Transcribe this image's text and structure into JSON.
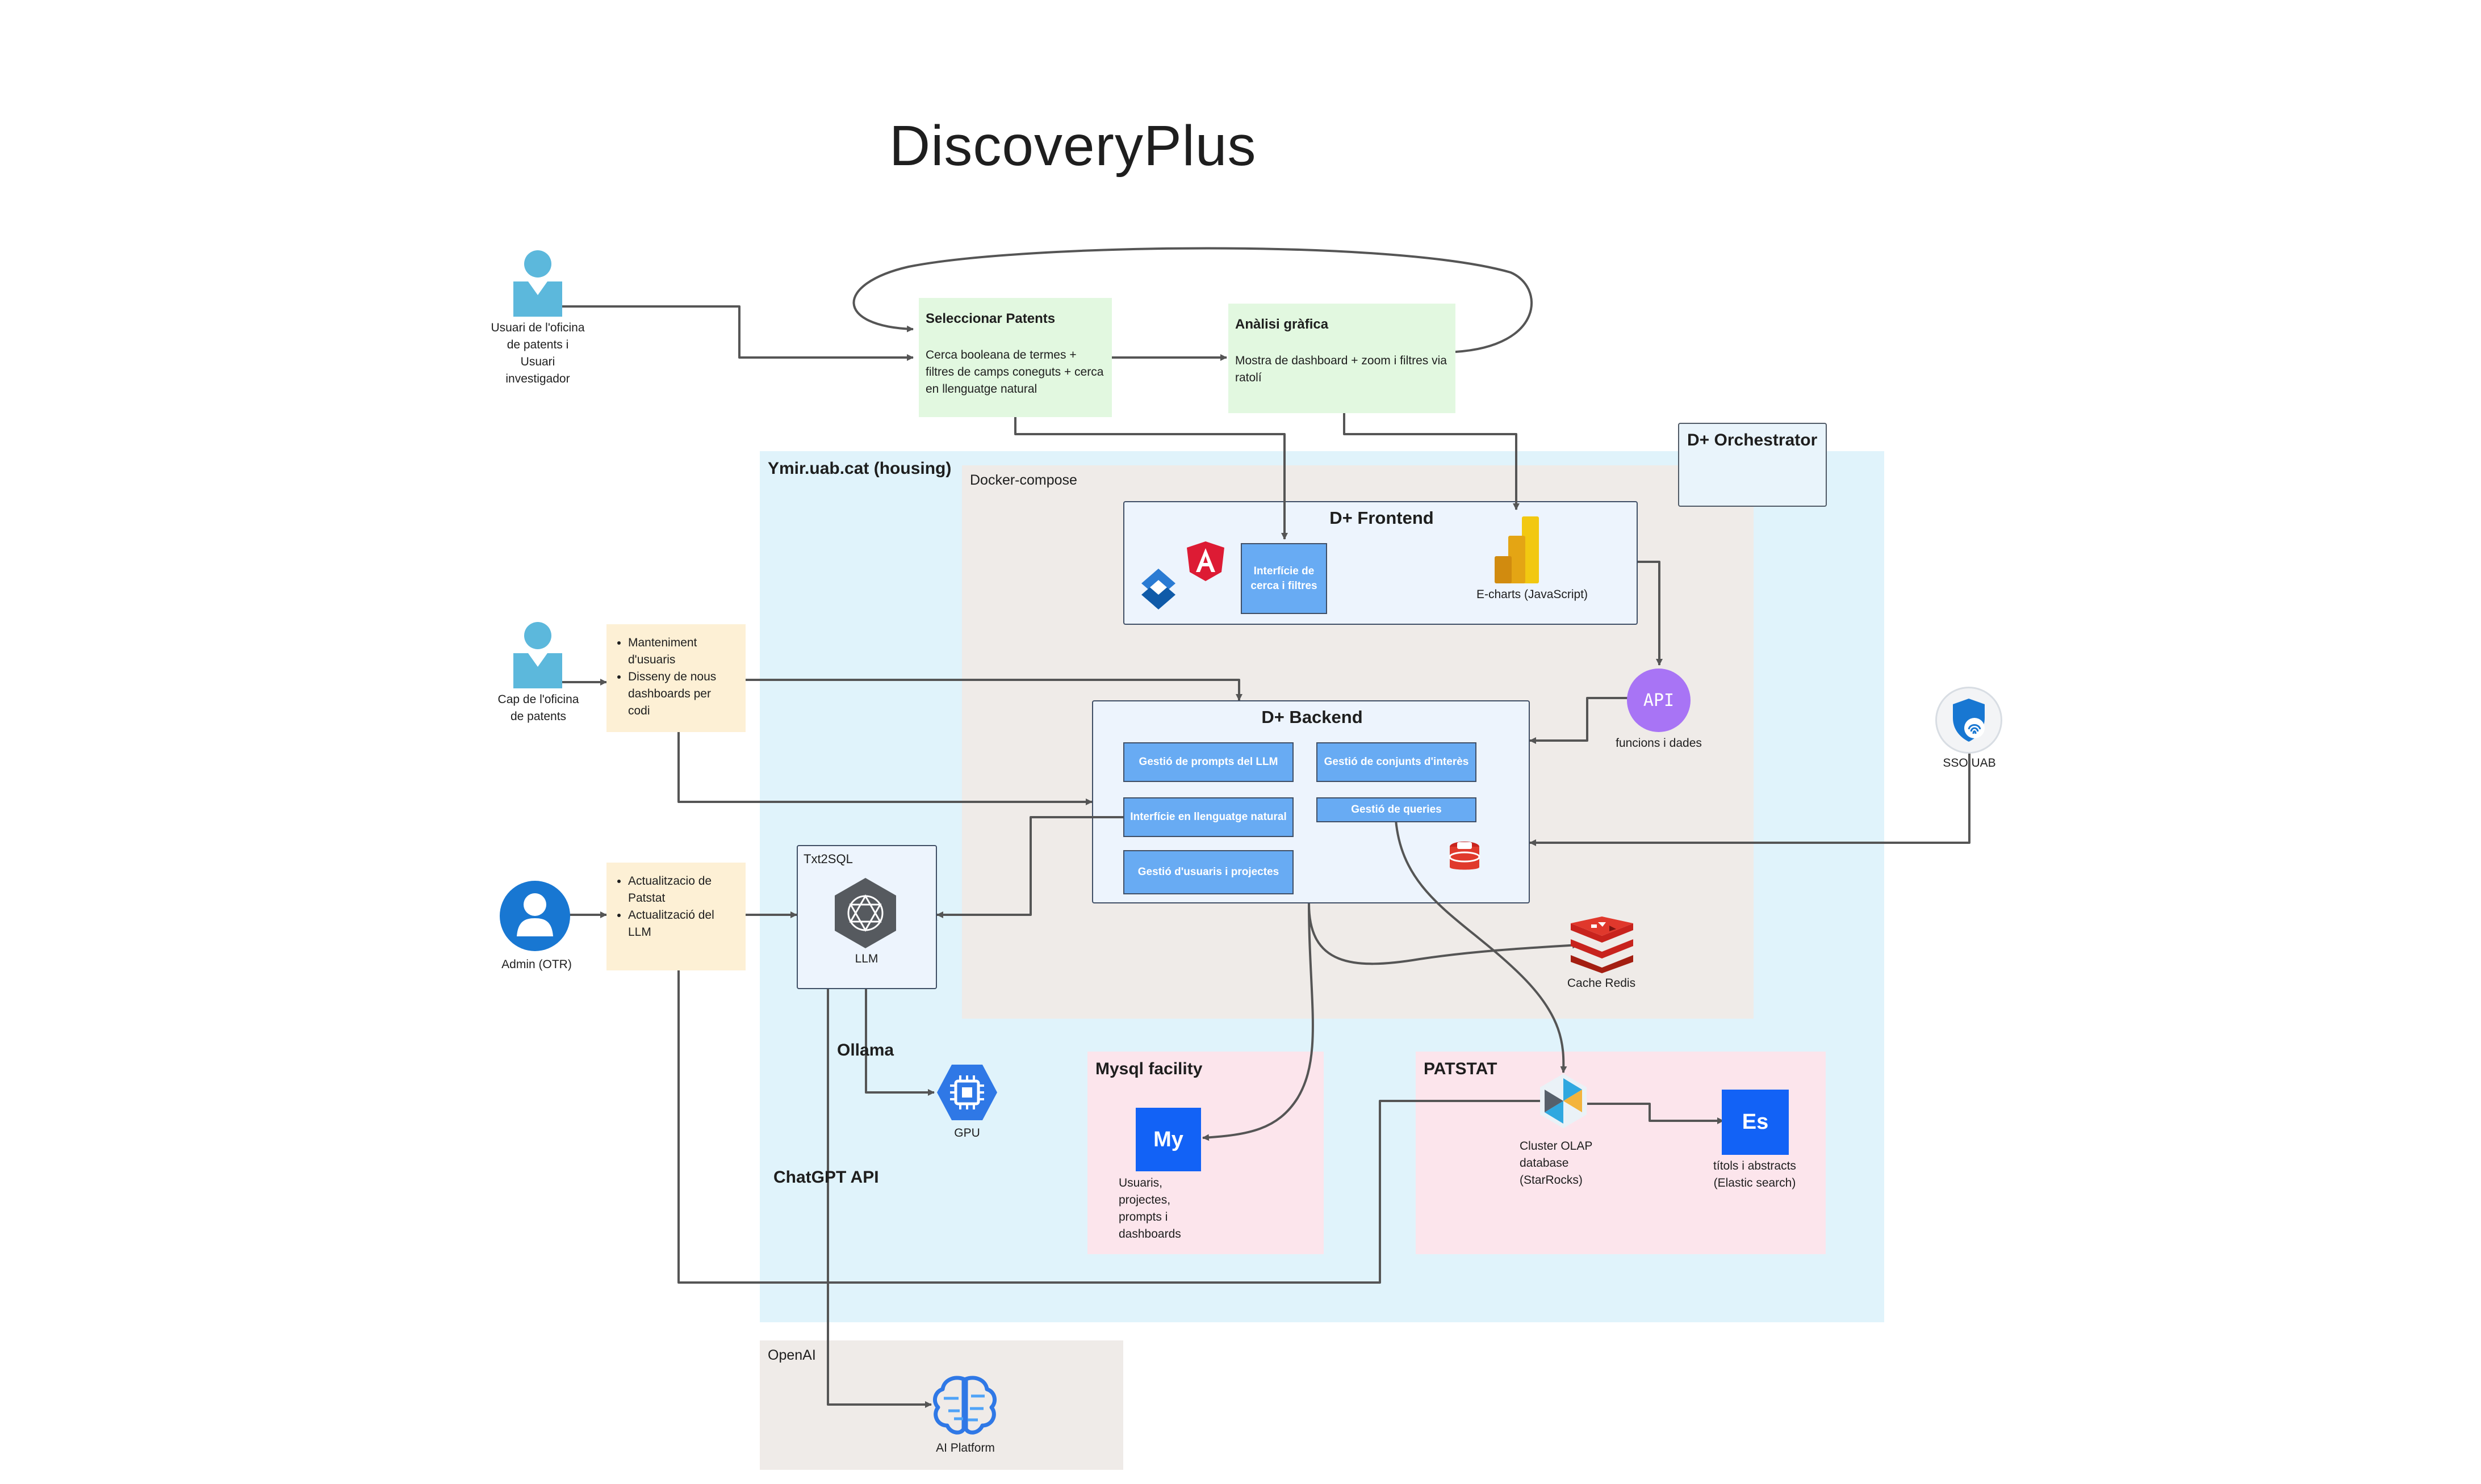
{
  "title": "DiscoveryPlus",
  "actors": {
    "user": "Usuari de l'oficina de patents i Usuari investigador",
    "head": "Cap de l'oficina de patents",
    "admin": "Admin (OTR)"
  },
  "process": {
    "select": {
      "heading": "Seleccionar Patents",
      "body": "Cerca booleana de termes + filtres de camps coneguts + cerca en llenguatge natural"
    },
    "analysis": {
      "heading": "Anàlisi gràfica",
      "body": "Mostra de dashboard + zoom i filtres via ratolí"
    }
  },
  "regions": {
    "ymir": "Ymir.uab.cat (housing)",
    "docker": "Docker-compose",
    "orchestrator": "D+ Orchestrator",
    "mysql": "Mysql facility",
    "patstat": "PATSTAT",
    "openai": "OpenAI",
    "txt2sql": "Txt2SQL"
  },
  "notes": {
    "head": [
      "Manteniment d'usuaris",
      "Disseny de nous dashboards per codi"
    ],
    "admin": [
      "Actualitzacio de Patstat",
      "Actualització del LLM"
    ]
  },
  "frontend": {
    "title": "D+  Frontend",
    "search_chip": "Interfície de cerca i filtres",
    "echarts": "E-charts (JavaScript)"
  },
  "backend": {
    "title": "D+  Backend",
    "prompts": "Gestió de prompts del LLM",
    "sets": "Gestió de conjunts d'interès",
    "nl": "Interfície en llenguatge natural",
    "queries": "Gestió de queries",
    "users": "Gestió d'usuaris i projectes"
  },
  "labels": {
    "api_badge": "API",
    "api": "funcions i dades",
    "sso": "SSO UAB",
    "llm": "LLM",
    "ollama": "Ollama",
    "gpu": "GPU",
    "chatgpt": "ChatGPT API",
    "redis": "Cache Redis",
    "mysql_badge": "My",
    "mysql_store": "Usuaris, projectes, prompts i dashboards",
    "olap": "Cluster OLAP database (StarRocks)",
    "es_badge": "Es",
    "es": "títols i abstracts (Elastic search)",
    "ai_platform": "AI Platform"
  },
  "colors": {
    "ymir": "#e0f3fb",
    "docker": "#efebe8",
    "pink": "#fce5ec",
    "green": "#e2f8e0",
    "note": "#fdf0d5",
    "chip": "#68abf3",
    "person": "#5cb8dc",
    "admin": "#1877d2",
    "api": "#a874f5",
    "mysql": "#1262f6",
    "redis": "#c8231d",
    "wire": "#555555"
  }
}
